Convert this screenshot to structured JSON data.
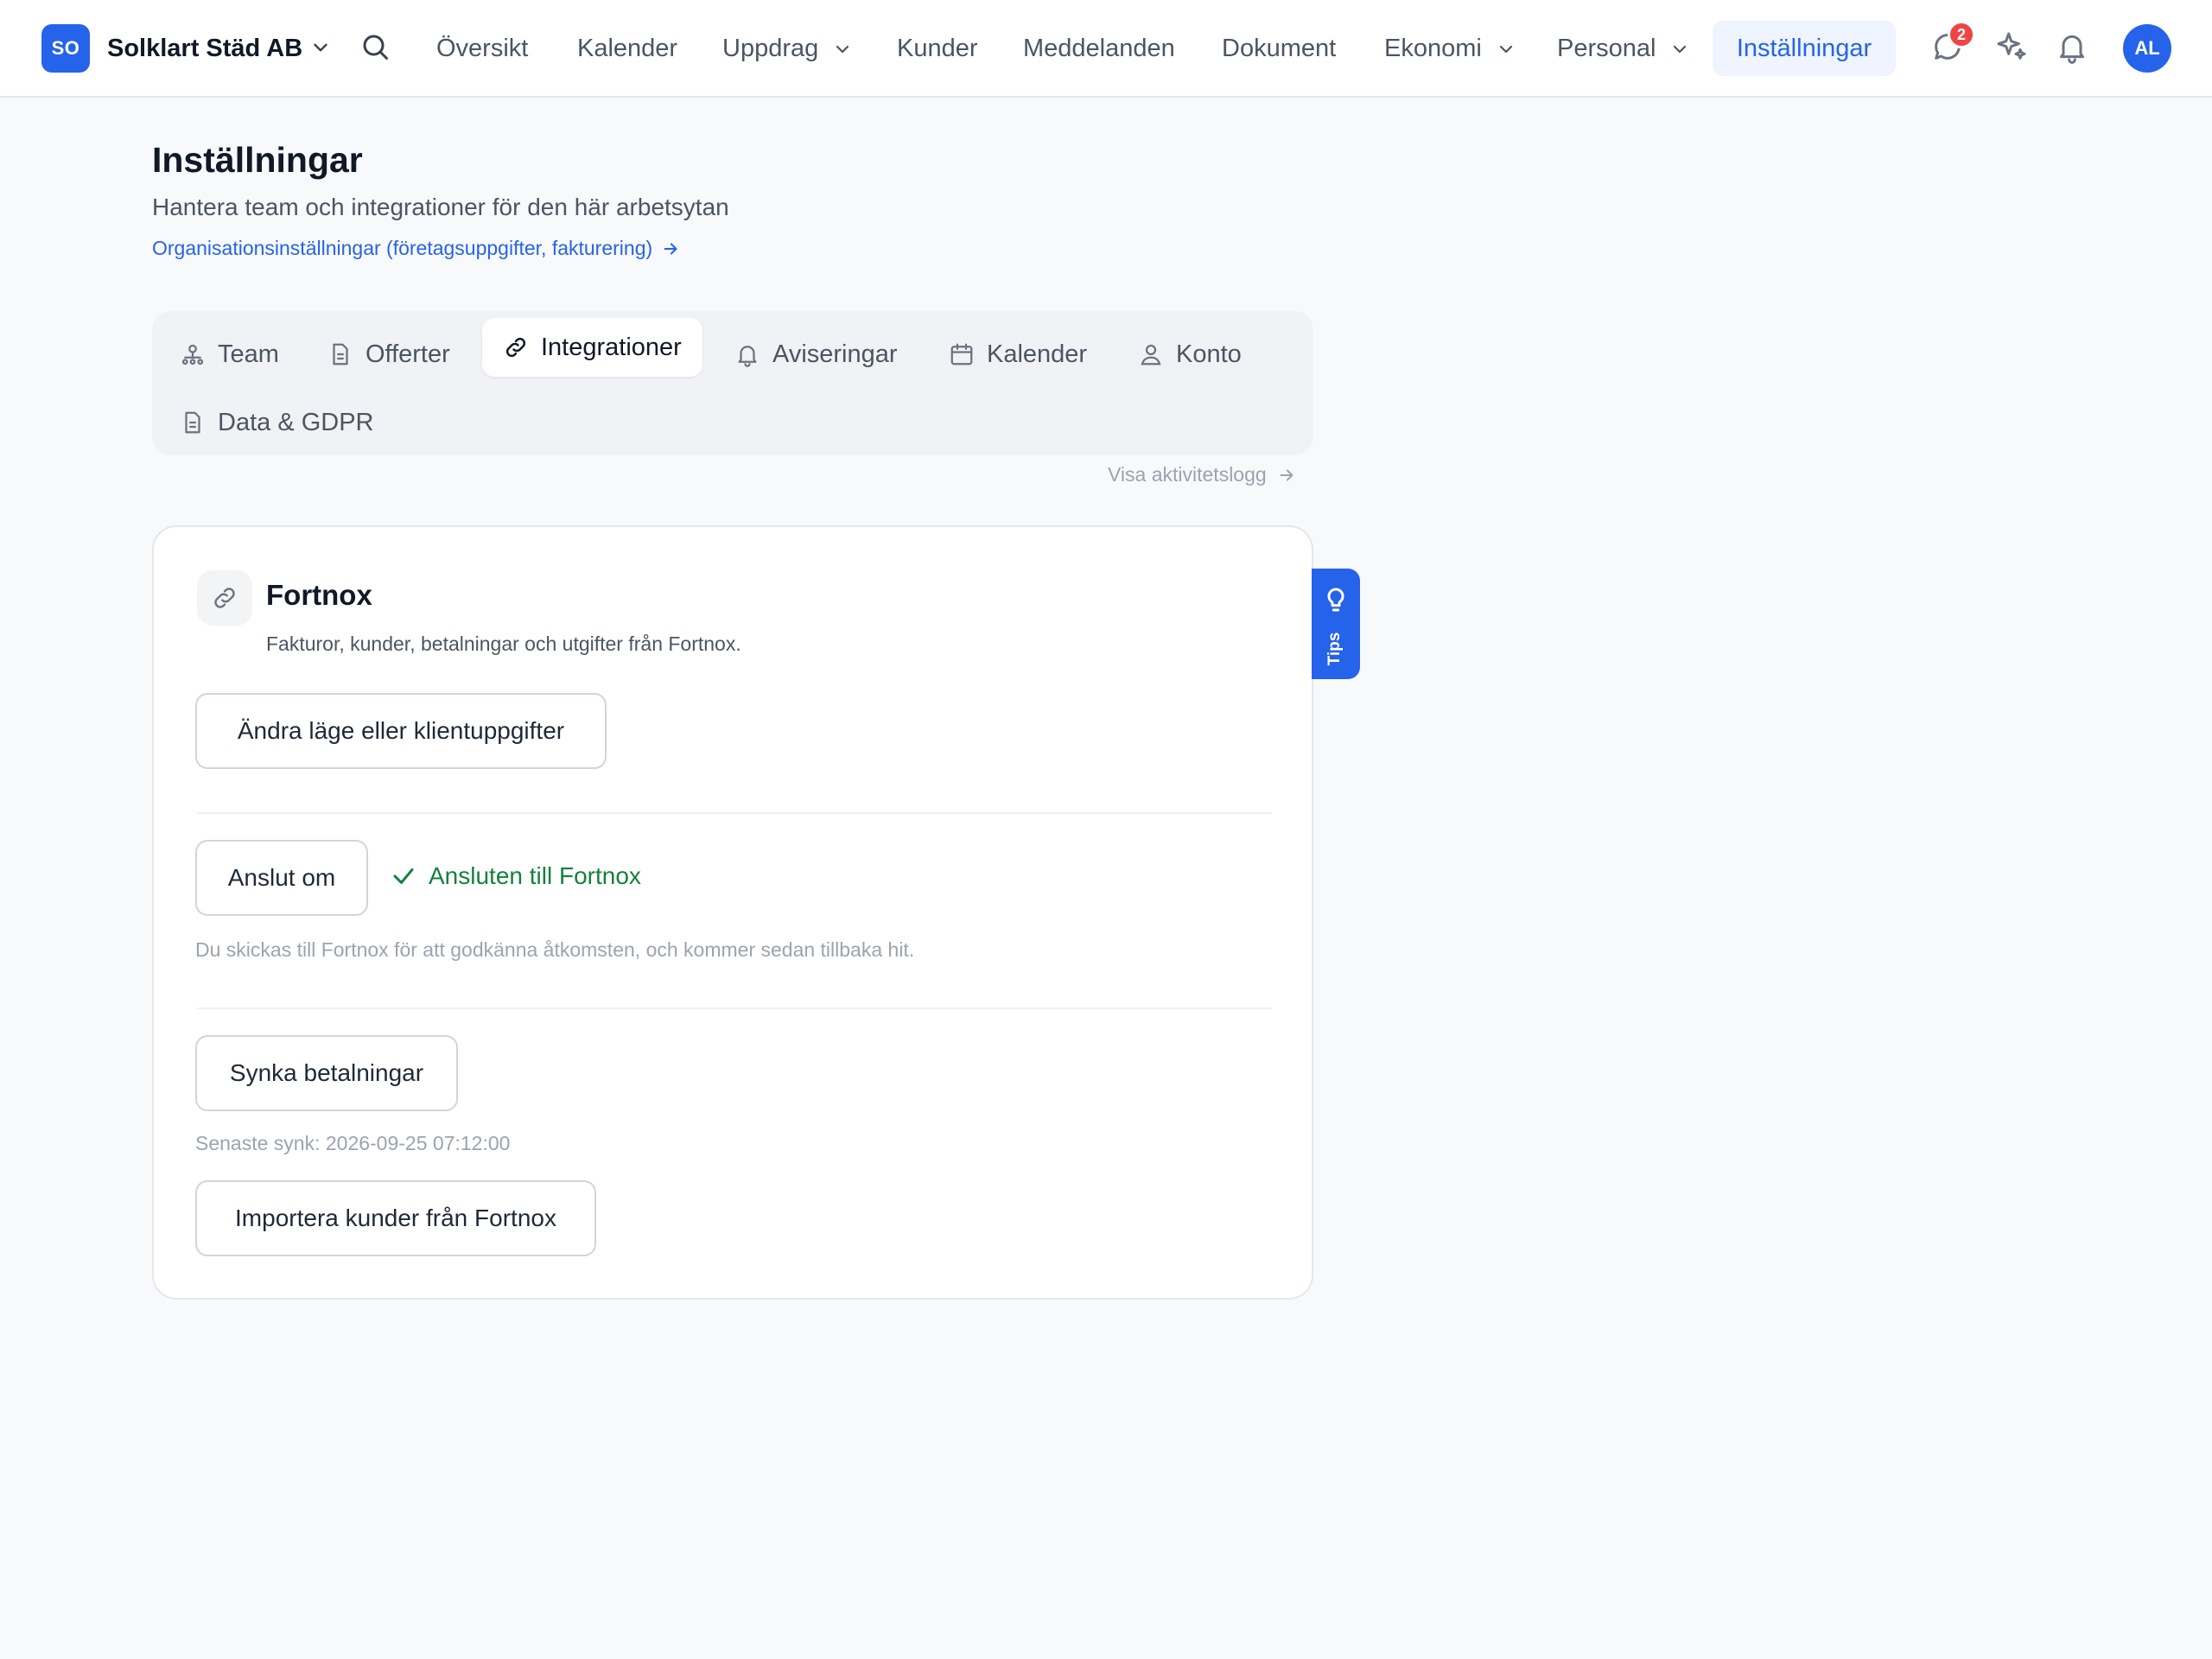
{
  "nav": {
    "org_initials": "SO",
    "org_name": "Solklart Städ AB",
    "items": [
      {
        "label": "Översikt"
      },
      {
        "label": "Kalender"
      },
      {
        "label": "Uppdrag"
      },
      {
        "label": "Kunder"
      },
      {
        "label": "Meddelanden"
      },
      {
        "label": "Dokument"
      },
      {
        "label": "Ekonomi"
      },
      {
        "label": "Personal"
      }
    ],
    "active_label": "Inställningar",
    "messages_badge": "2",
    "user_initials": "AL",
    "icons": [
      "search-icon",
      "chat-icon",
      "sparkles-icon",
      "bell-icon"
    ]
  },
  "header": {
    "title": "Inställningar",
    "subtitle": "Hantera team och integrationer för den här arbetsytan",
    "org_link": "Organisationsinställningar (företagsuppgifter, fakturering)"
  },
  "tabs": [
    {
      "label": "Team",
      "icon": "team-icon"
    },
    {
      "label": "Offerter",
      "icon": "document-icon"
    },
    {
      "label": "Integrationer",
      "icon": "link-icon",
      "active": true
    },
    {
      "label": "Aviseringar",
      "icon": "bell-icon"
    },
    {
      "label": "Kalender",
      "icon": "calendar-icon"
    },
    {
      "label": "Konto",
      "icon": "user-icon"
    },
    {
      "label": "Data & GDPR",
      "icon": "document-icon"
    }
  ],
  "activity_link": "Visa aktivitetslogg",
  "integration": {
    "title": "Fortnox",
    "description": "Fakturor, kunder, betalningar och utgifter från Fortnox.",
    "change_mode_button": "Ändra läge eller klientuppgifter",
    "reconnect_button": "Anslut om",
    "status": "Ansluten till Fortnox",
    "reconnect_hint": "Du skickas till Fortnox för att godkänna åtkomsten, och kommer sedan tillbaka hit.",
    "sync_button": "Synka betalningar",
    "last_sync": "Senaste synk: 2026-09-25 07:12:00",
    "import_button": "Importera kunder från Fortnox"
  },
  "tips_tab": "Tips",
  "colors": {
    "accent": "#2563eb",
    "success": "#15803d",
    "badge": "#ef4444",
    "background": "#f8f9fb"
  }
}
